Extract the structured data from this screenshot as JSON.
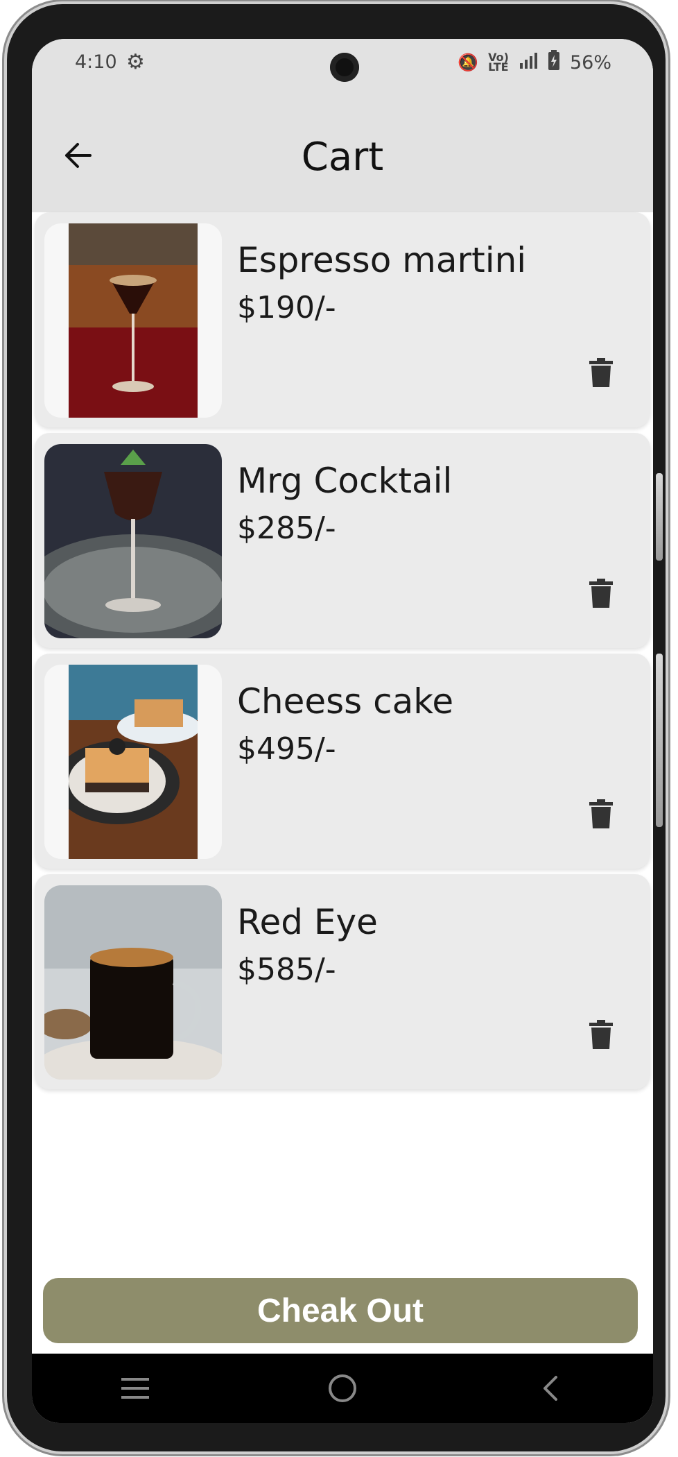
{
  "status": {
    "time": "4:10",
    "battery": "56%",
    "icons": [
      "gear-icon",
      "mute-icon",
      "volte-icon",
      "signal-icon",
      "battery-icon"
    ]
  },
  "header": {
    "title": "Cart",
    "back_icon": "arrow-left-icon"
  },
  "cart": {
    "items": [
      {
        "name": "Espresso martini",
        "price": "$190/-",
        "image": "espresso-martini-photo"
      },
      {
        "name": "Mrg Cocktail",
        "price": "$285/-",
        "image": "mrg-cocktail-photo"
      },
      {
        "name": "Cheess cake",
        "price": "$495/-",
        "image": "cheesecake-photo"
      },
      {
        "name": "Red Eye",
        "price": "$585/-",
        "image": "red-eye-coffee-photo"
      }
    ]
  },
  "checkout": {
    "label": "Cheak Out",
    "color": "#8e8d6b"
  },
  "navbar": {
    "icons": [
      "menu-icon",
      "home-icon",
      "back-icon"
    ]
  }
}
